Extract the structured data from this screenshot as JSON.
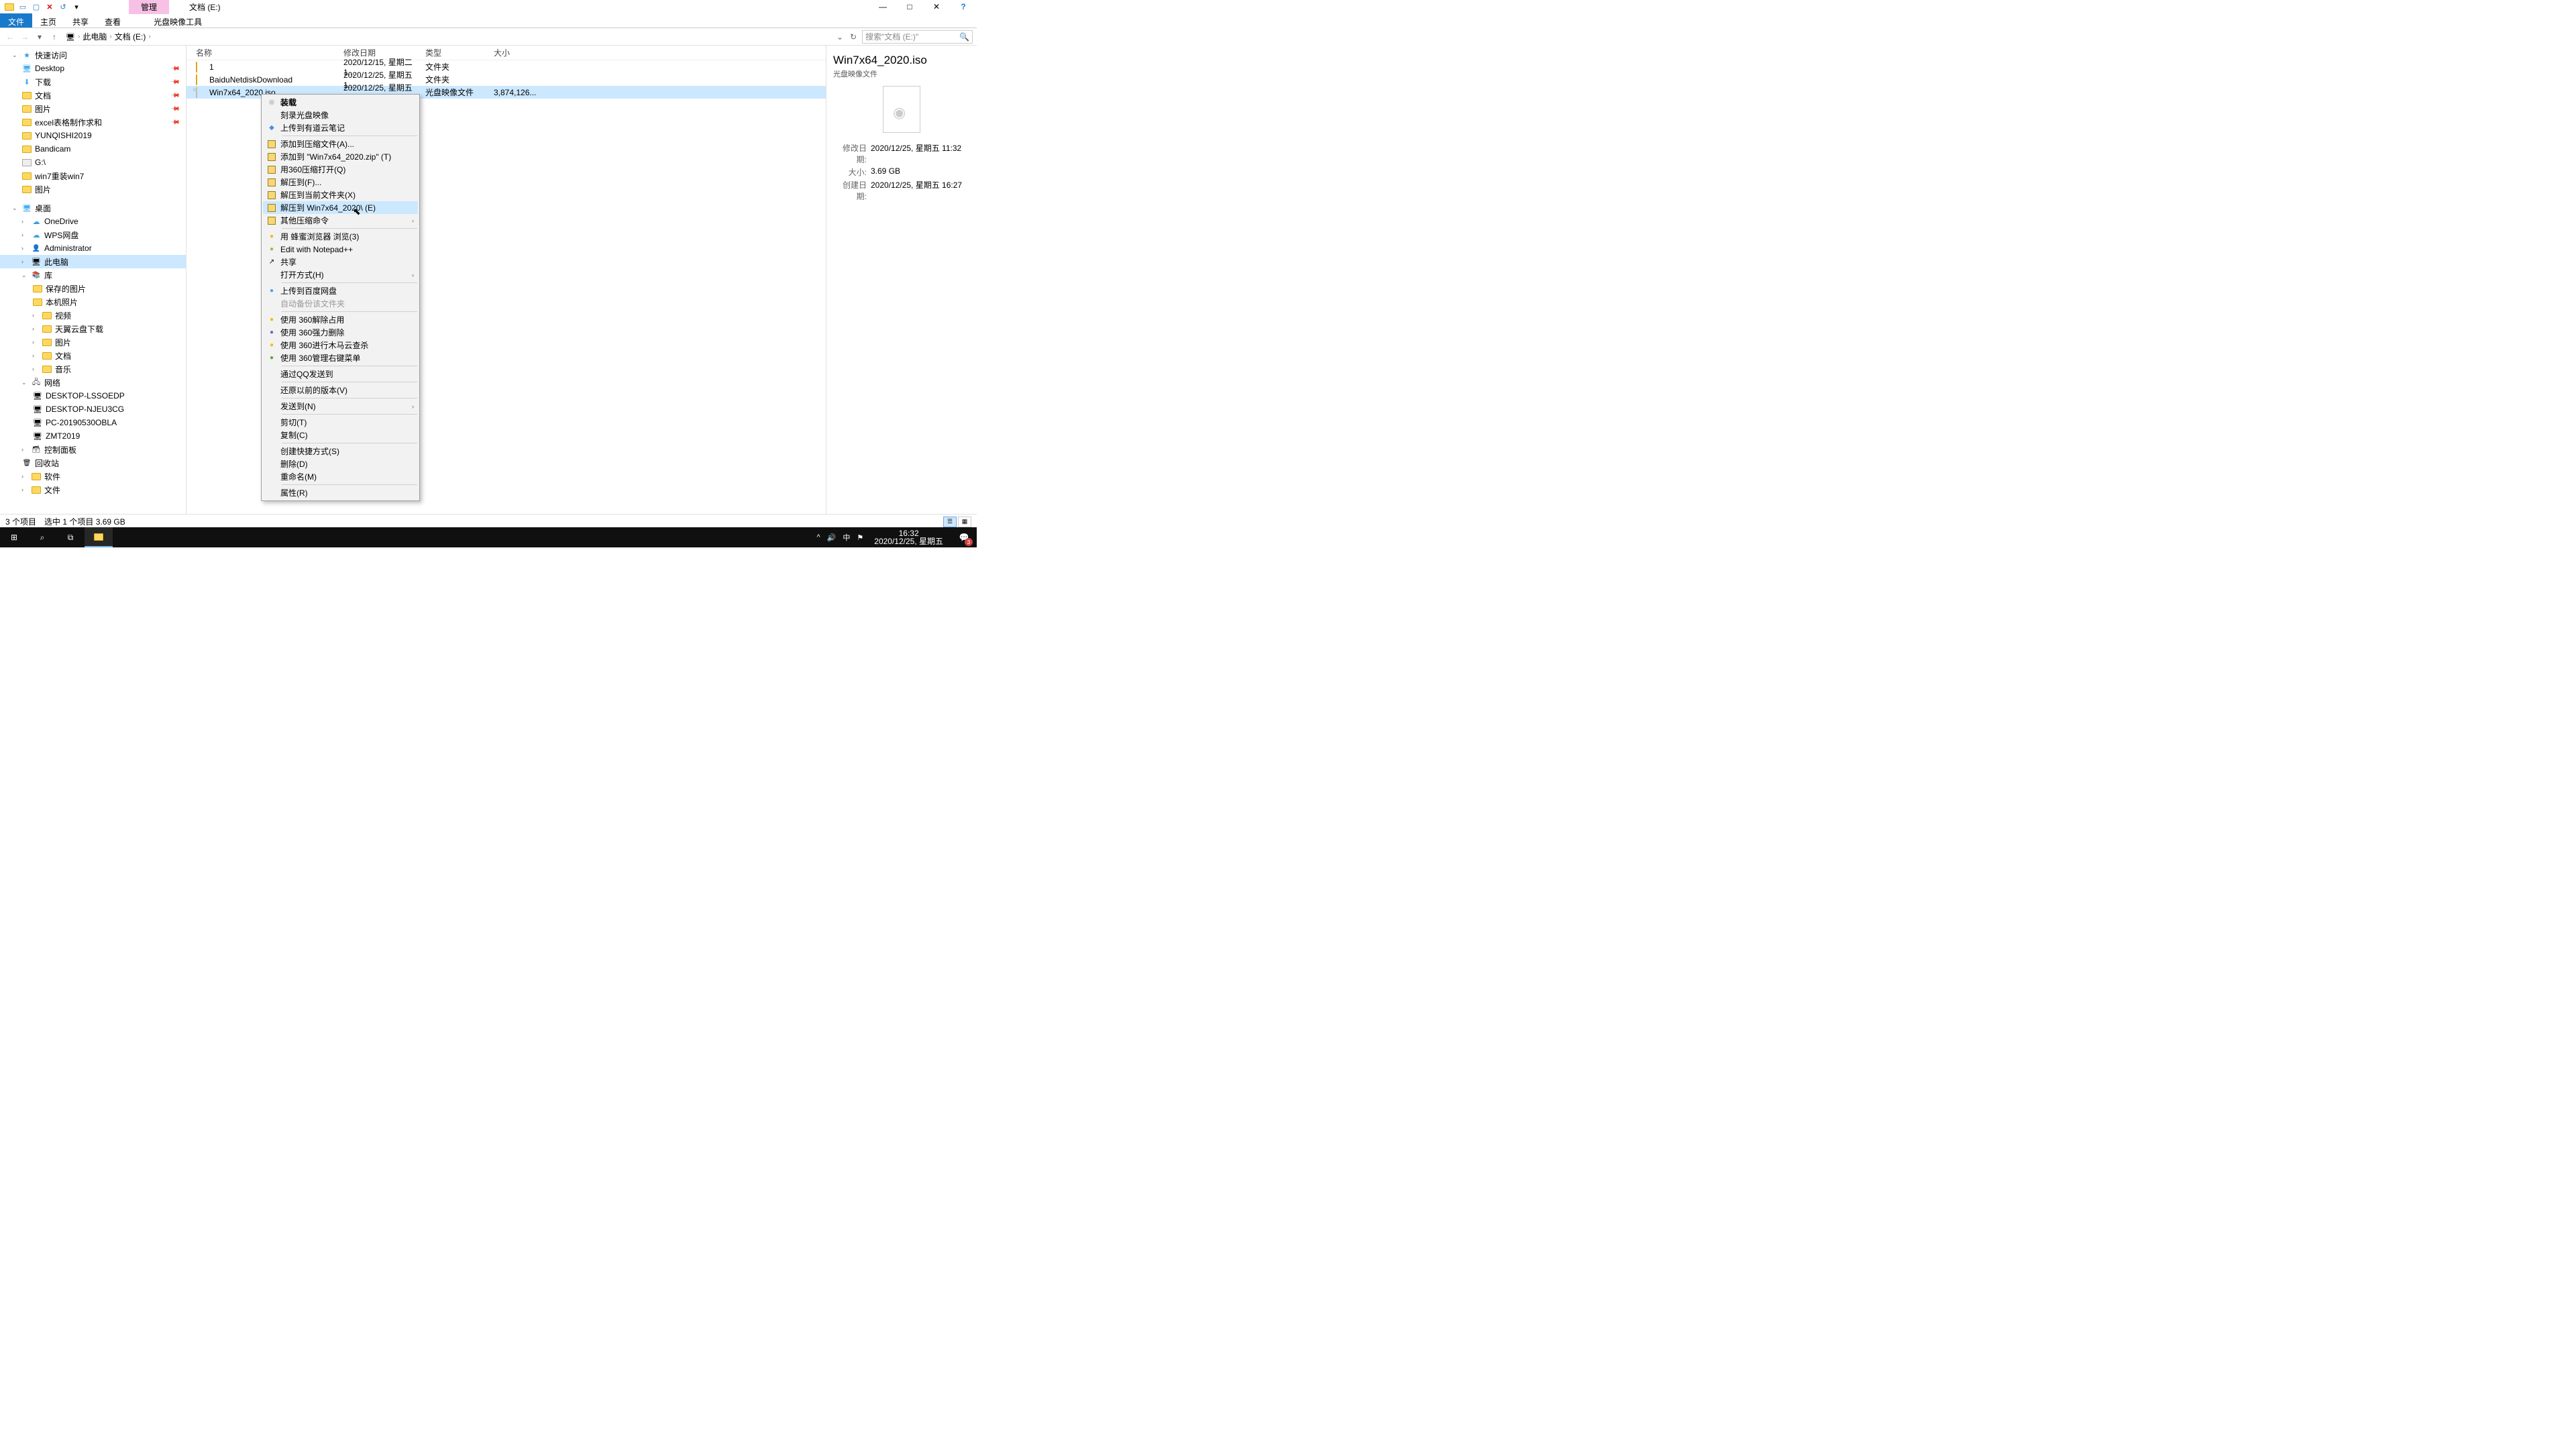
{
  "title_ctx_tab": "管理",
  "title_text": "文档 (E:)",
  "ribbon": {
    "file": "文件",
    "home": "主页",
    "share": "共享",
    "view": "查看",
    "tool": "光盘映像工具"
  },
  "breadcrumb": {
    "root": "此电脑",
    "folder": "文档 (E:)"
  },
  "search_placeholder": "搜索\"文档 (E:)\"",
  "tree": {
    "quick": "快速访问",
    "desktop": "Desktop",
    "downloads": "下载",
    "documents": "文档",
    "pictures": "图片",
    "excel": "excel表格制作求和",
    "yunqishi": "YUNQISHI2019",
    "bandicam": "Bandicam",
    "g": "G:\\",
    "win7": "win7重装win7",
    "pictures2": "图片",
    "desk_root": "桌面",
    "onedrive": "OneDrive",
    "wps": "WPS网盘",
    "admin": "Administrator",
    "pc": "此电脑",
    "lib": "库",
    "saved": "保存的图片",
    "local": "本机照片",
    "video": "视频",
    "tianyi": "天翼云盘下载",
    "pic3": "图片",
    "doc3": "文档",
    "music": "音乐",
    "network": "网络",
    "d1": "DESKTOP-LSSOEDP",
    "d2": "DESKTOP-NJEU3CG",
    "d3": "PC-20190530OBLA",
    "d4": "ZMT2019",
    "ctrl": "控制面板",
    "bin": "回收站",
    "soft": "软件",
    "files": "文件"
  },
  "cols": {
    "name": "名称",
    "date": "修改日期",
    "type": "类型",
    "size": "大小"
  },
  "rows": [
    {
      "name": "1",
      "date": "2020/12/15, 星期二 1...",
      "type": "文件夹",
      "size": ""
    },
    {
      "name": "BaiduNetdiskDownload",
      "date": "2020/12/25, 星期五 1...",
      "type": "文件夹",
      "size": ""
    },
    {
      "name": "Win7x64_2020.iso",
      "date": "2020/12/25, 星期五 1...",
      "type": "光盘映像文件",
      "size": "3,874,126..."
    }
  ],
  "ctx": {
    "mount": "装载",
    "burn": "刻录光盘映像",
    "youdao": "上传到有道云笔记",
    "archive": "添加到压缩文件(A)...",
    "addzip": "添加到 \"Win7x64_2020.zip\" (T)",
    "open360": "用360压缩打开(Q)",
    "extract": "解压到(F)...",
    "extracthere": "解压到当前文件夹(X)",
    "extractto": "解压到 Win7x64_2020\\ (E)",
    "other": "其他压缩命令",
    "bee": "用 蜂蜜浏览器 浏览(3)",
    "npp": "Edit with Notepad++",
    "share": "共享",
    "openwith": "打开方式(H)",
    "baidu": "上传到百度网盘",
    "autobak": "自动备份该文件夹",
    "unlock360": "使用 360解除占用",
    "force360": "使用 360强力删除",
    "virus360": "使用 360进行木马云查杀",
    "manage360": "使用 360管理右键菜单",
    "qqsend": "通过QQ发送到",
    "restore": "还原以前的版本(V)",
    "sendto": "发送到(N)",
    "cut": "剪切(T)",
    "copy": "复制(C)",
    "shortcut": "创建快捷方式(S)",
    "delete": "删除(D)",
    "rename": "重命名(M)",
    "props": "属性(R)"
  },
  "details": {
    "title": "Win7x64_2020.iso",
    "type": "光盘映像文件",
    "mod_k": "修改日期:",
    "mod_v": "2020/12/25, 星期五 11:32",
    "size_k": "大小:",
    "size_v": "3.69 GB",
    "create_k": "创建日期:",
    "create_v": "2020/12/25, 星期五 16:27"
  },
  "status": {
    "count": "3 个项目",
    "sel": "选中 1 个项目  3.69 GB"
  },
  "clock": {
    "time": "16:32",
    "date": "2020/12/25, 星期五"
  },
  "notif_badge": "3",
  "ime": "中"
}
